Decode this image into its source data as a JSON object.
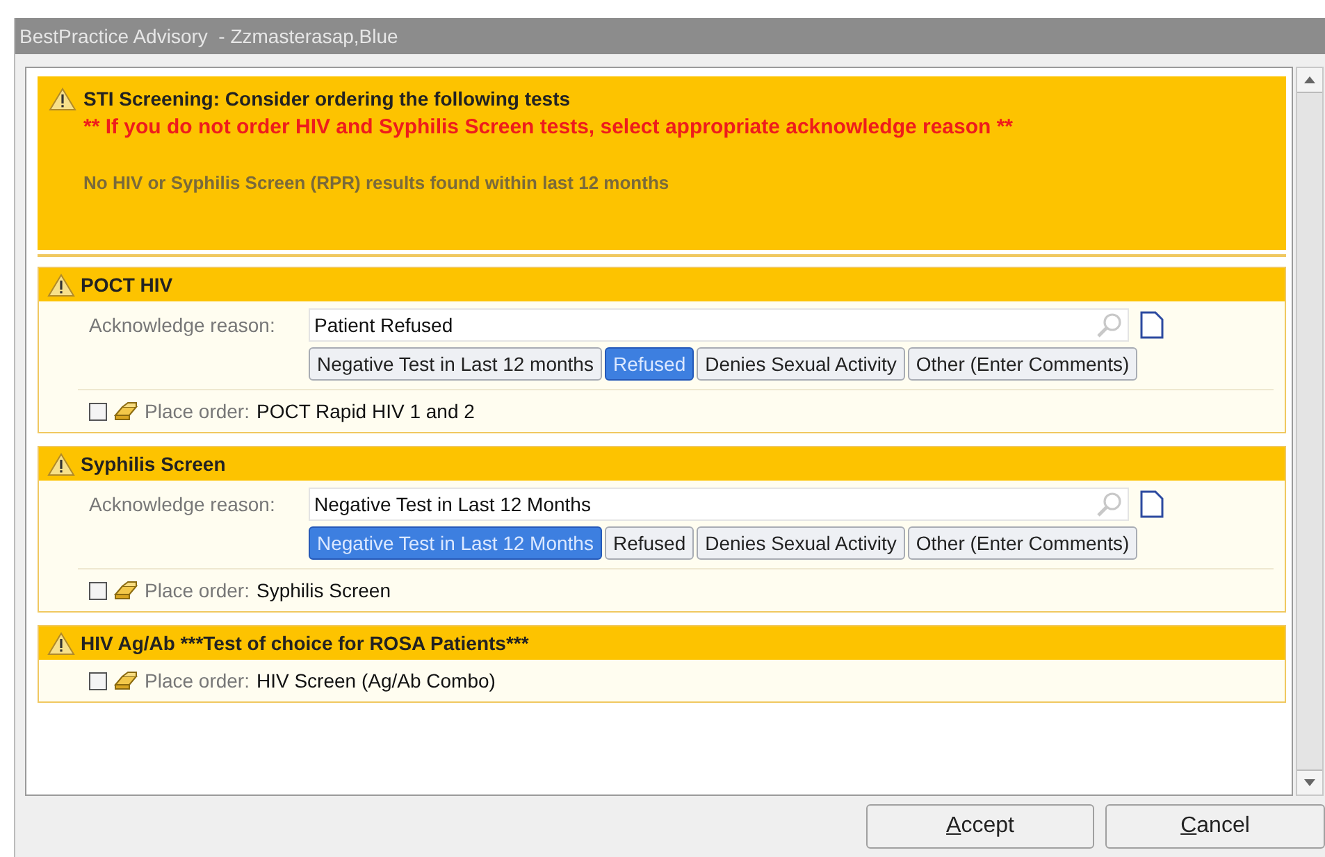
{
  "window": {
    "title": "BestPractice Advisory  - Zzmasterasap,Blue"
  },
  "alert": {
    "title": "STI Screening: Consider ordering the following tests",
    "warning": "** If you do not order HIV and Syphilis Screen tests, select appropriate acknowledge reason **",
    "note": "No HIV or Syphilis Screen (RPR) results found within last 12 months"
  },
  "sections": [
    {
      "title": "POCT HIV",
      "acknowledge": {
        "label": "Acknowledge reason:",
        "value": "Patient Refused",
        "options": [
          {
            "label": "Negative Test in Last 12 months",
            "selected": false
          },
          {
            "label": "Refused",
            "selected": true
          },
          {
            "label": "Denies Sexual Activity",
            "selected": false
          },
          {
            "label": "Other (Enter Comments)",
            "selected": false
          }
        ]
      },
      "order": {
        "checked": false,
        "prefix": "Place order:",
        "name": "POCT Rapid HIV 1 and 2"
      }
    },
    {
      "title": "Syphilis Screen",
      "acknowledge": {
        "label": "Acknowledge reason:",
        "value": "Negative Test in Last 12 Months",
        "options": [
          {
            "label": "Negative Test in Last 12 Months",
            "selected": true
          },
          {
            "label": "Refused",
            "selected": false
          },
          {
            "label": "Denies Sexual Activity",
            "selected": false
          },
          {
            "label": "Other (Enter Comments)",
            "selected": false
          }
        ]
      },
      "order": {
        "checked": false,
        "prefix": "Place order:",
        "name": "Syphilis Screen"
      }
    },
    {
      "title": "HIV Ag/Ab ***Test of choice for ROSA Patients***",
      "order": {
        "checked": false,
        "prefix": "Place order:",
        "name": "HIV Screen (Ag/Ab Combo)"
      }
    }
  ],
  "buttons": [
    {
      "label": "Accept",
      "mnemonic_underlined": true
    },
    {
      "label": "Cancel",
      "mnemonic_underlined": true
    }
  ]
}
